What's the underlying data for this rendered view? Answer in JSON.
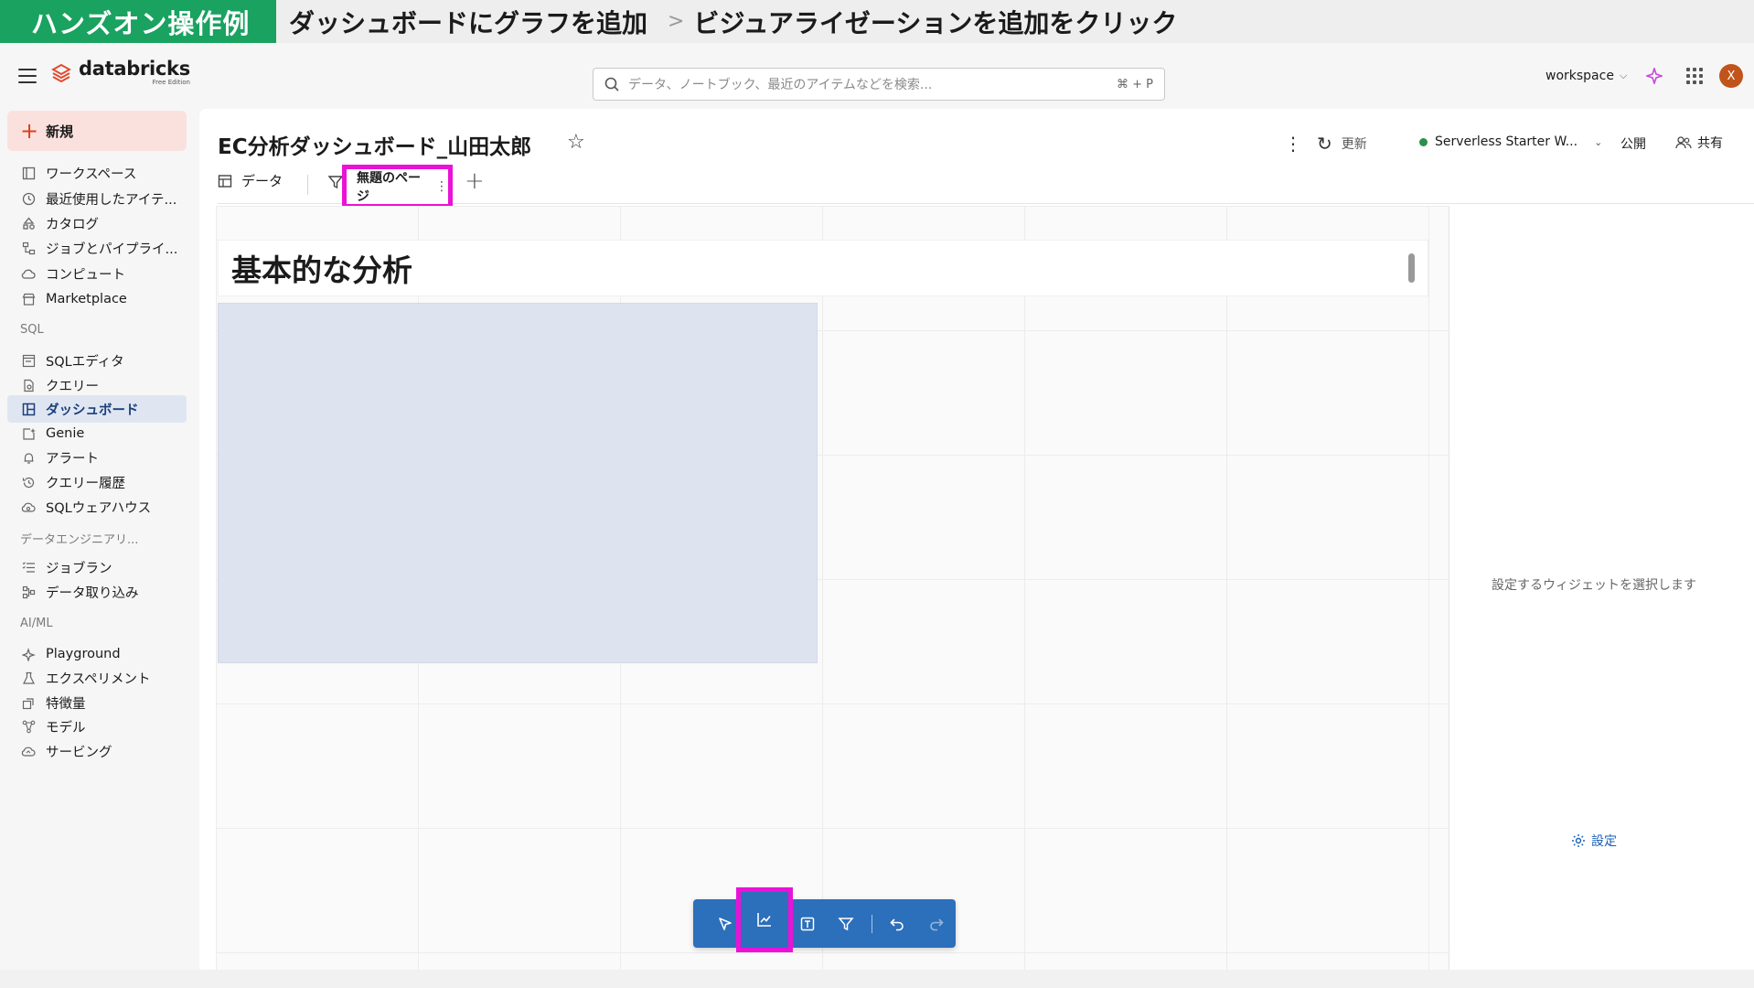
{
  "banner": {
    "tag": "ハンズオン操作例",
    "step1": "ダッシュボードにグラフを追加",
    "separator": ">",
    "step2": "ビジュアライゼーションを追加をクリック"
  },
  "topnav": {
    "logo": "databricks",
    "logo_sub": "Free Edition",
    "search_placeholder": "データ、ノートブック、最近のアイテムなどを検索...",
    "search_shortcut": "⌘ + P",
    "workspace": "workspace",
    "avatar_initial": "X"
  },
  "sidebar": {
    "new_label": "新規",
    "items_main": [
      {
        "label": "ワークスペース",
        "icon": "folder-icon"
      },
      {
        "label": "最近使用したアイテ...",
        "icon": "clock-icon"
      },
      {
        "label": "カタログ",
        "icon": "catalog-icon"
      },
      {
        "label": "ジョブとパイプライ...",
        "icon": "workflow-icon"
      },
      {
        "label": "コンピュート",
        "icon": "cloud-icon"
      },
      {
        "label": "Marketplace",
        "icon": "store-icon"
      }
    ],
    "section_sql": "SQL",
    "items_sql": [
      {
        "label": "SQLエディタ",
        "icon": "editor-icon"
      },
      {
        "label": "クエリー",
        "icon": "query-icon"
      },
      {
        "label": "ダッシュボード",
        "icon": "dashboard-icon",
        "active": true
      },
      {
        "label": "Genie",
        "icon": "genie-icon"
      },
      {
        "label": "アラート",
        "icon": "bell-icon"
      },
      {
        "label": "クエリー履歴",
        "icon": "history-icon"
      },
      {
        "label": "SQLウェアハウス",
        "icon": "warehouse-icon"
      }
    ],
    "section_de": "データエンジニアリ...",
    "items_de": [
      {
        "label": "ジョブラン",
        "icon": "list-icon"
      },
      {
        "label": "データ取り込み",
        "icon": "ingest-icon"
      }
    ],
    "section_ai": "AI/ML",
    "items_ai": [
      {
        "label": "Playground",
        "icon": "sparkle-icon"
      },
      {
        "label": "エクスペリメント",
        "icon": "flask-icon"
      },
      {
        "label": "特徴量",
        "icon": "feature-icon"
      },
      {
        "label": "モデル",
        "icon": "model-icon"
      },
      {
        "label": "サービング",
        "icon": "serving-icon"
      }
    ]
  },
  "main": {
    "title": "EC分析ダッシュボード_山田太郎",
    "refresh_label": "更新",
    "warehouse_label": "Serverless Starter W...",
    "warehouse_status_color": "#2c8f4d",
    "publish_label": "公開",
    "share_label": "共有",
    "tab_data_label": "データ",
    "tab_page_label": "無題のページ",
    "canvas_title": "基本的な分析",
    "right_panel_message": "設定するウィジェットを選択します",
    "settings_label": "設定"
  },
  "colors": {
    "banner_green": "#1aa260",
    "highlight_magenta": "#ea12d8",
    "toolbar_blue": "#2c6fbb",
    "new_button_bg": "#fbe1de",
    "active_item_bg": "#dfe6f2"
  }
}
